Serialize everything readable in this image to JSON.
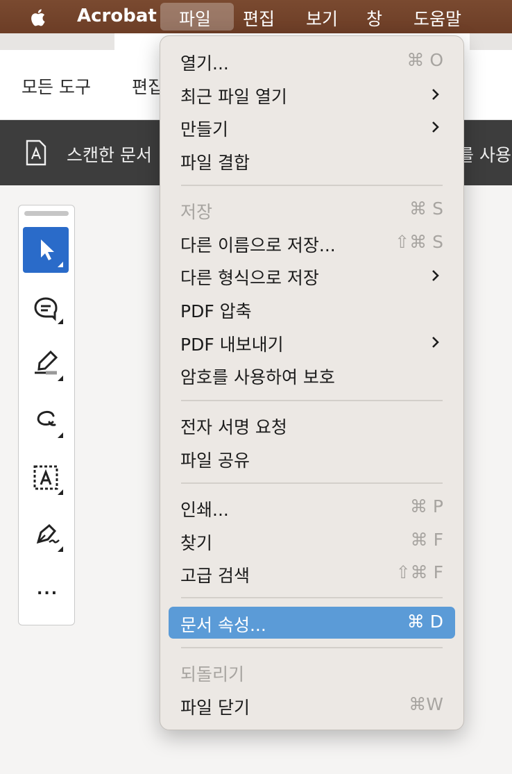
{
  "menubar": {
    "app_name": "Acrobat",
    "items": [
      "파일",
      "편집",
      "보기",
      "창",
      "도움말"
    ],
    "active_item": "파일"
  },
  "toolbar": {
    "all_tools": "모든 도구",
    "edit_partial": "편집"
  },
  "banner": {
    "text_left": "스캔한 문서",
    "text_right": "를 사용하"
  },
  "tool_panel": {
    "tools": [
      "select-tool",
      "comment-tool",
      "highlight-tool",
      "draw-tool",
      "text-recognition-tool",
      "sign-tool",
      "more-tools"
    ],
    "more_label": "..."
  },
  "file_menu": {
    "items": [
      {
        "label": "열기...",
        "shortcut": "⌘ O"
      },
      {
        "label": "최근 파일 열기",
        "submenu": true
      },
      {
        "label": "만들기",
        "submenu": true
      },
      {
        "label": "파일 결합"
      },
      {
        "label": "저장",
        "shortcut": "⌘ S",
        "disabled": true
      },
      {
        "label": "다른 이름으로 저장...",
        "shortcut": "⇧⌘ S"
      },
      {
        "label": "다른 형식으로 저장",
        "submenu": true
      },
      {
        "label": "PDF 압축"
      },
      {
        "label": "PDF 내보내기",
        "submenu": true
      },
      {
        "label": "암호를 사용하여 보호"
      },
      {
        "label": "전자 서명 요청"
      },
      {
        "label": "파일 공유"
      },
      {
        "label": "인쇄...",
        "shortcut": "⌘ P"
      },
      {
        "label": "찾기",
        "shortcut": "⌘ F"
      },
      {
        "label": "고급 검색",
        "shortcut": "⇧⌘ F"
      },
      {
        "label": "문서 속성...",
        "shortcut": "⌘ D",
        "highlighted": true
      },
      {
        "label": "되돌리기",
        "disabled": true
      },
      {
        "label": "파일 닫기",
        "shortcut": "⌘W"
      }
    ]
  },
  "colors": {
    "menubar_bg": "#6c3d26",
    "menu_bg": "#ece8e4",
    "highlight": "#5b9bd7",
    "tool_selected": "#2a6bc9",
    "banner_bg": "#3d3d3d"
  }
}
